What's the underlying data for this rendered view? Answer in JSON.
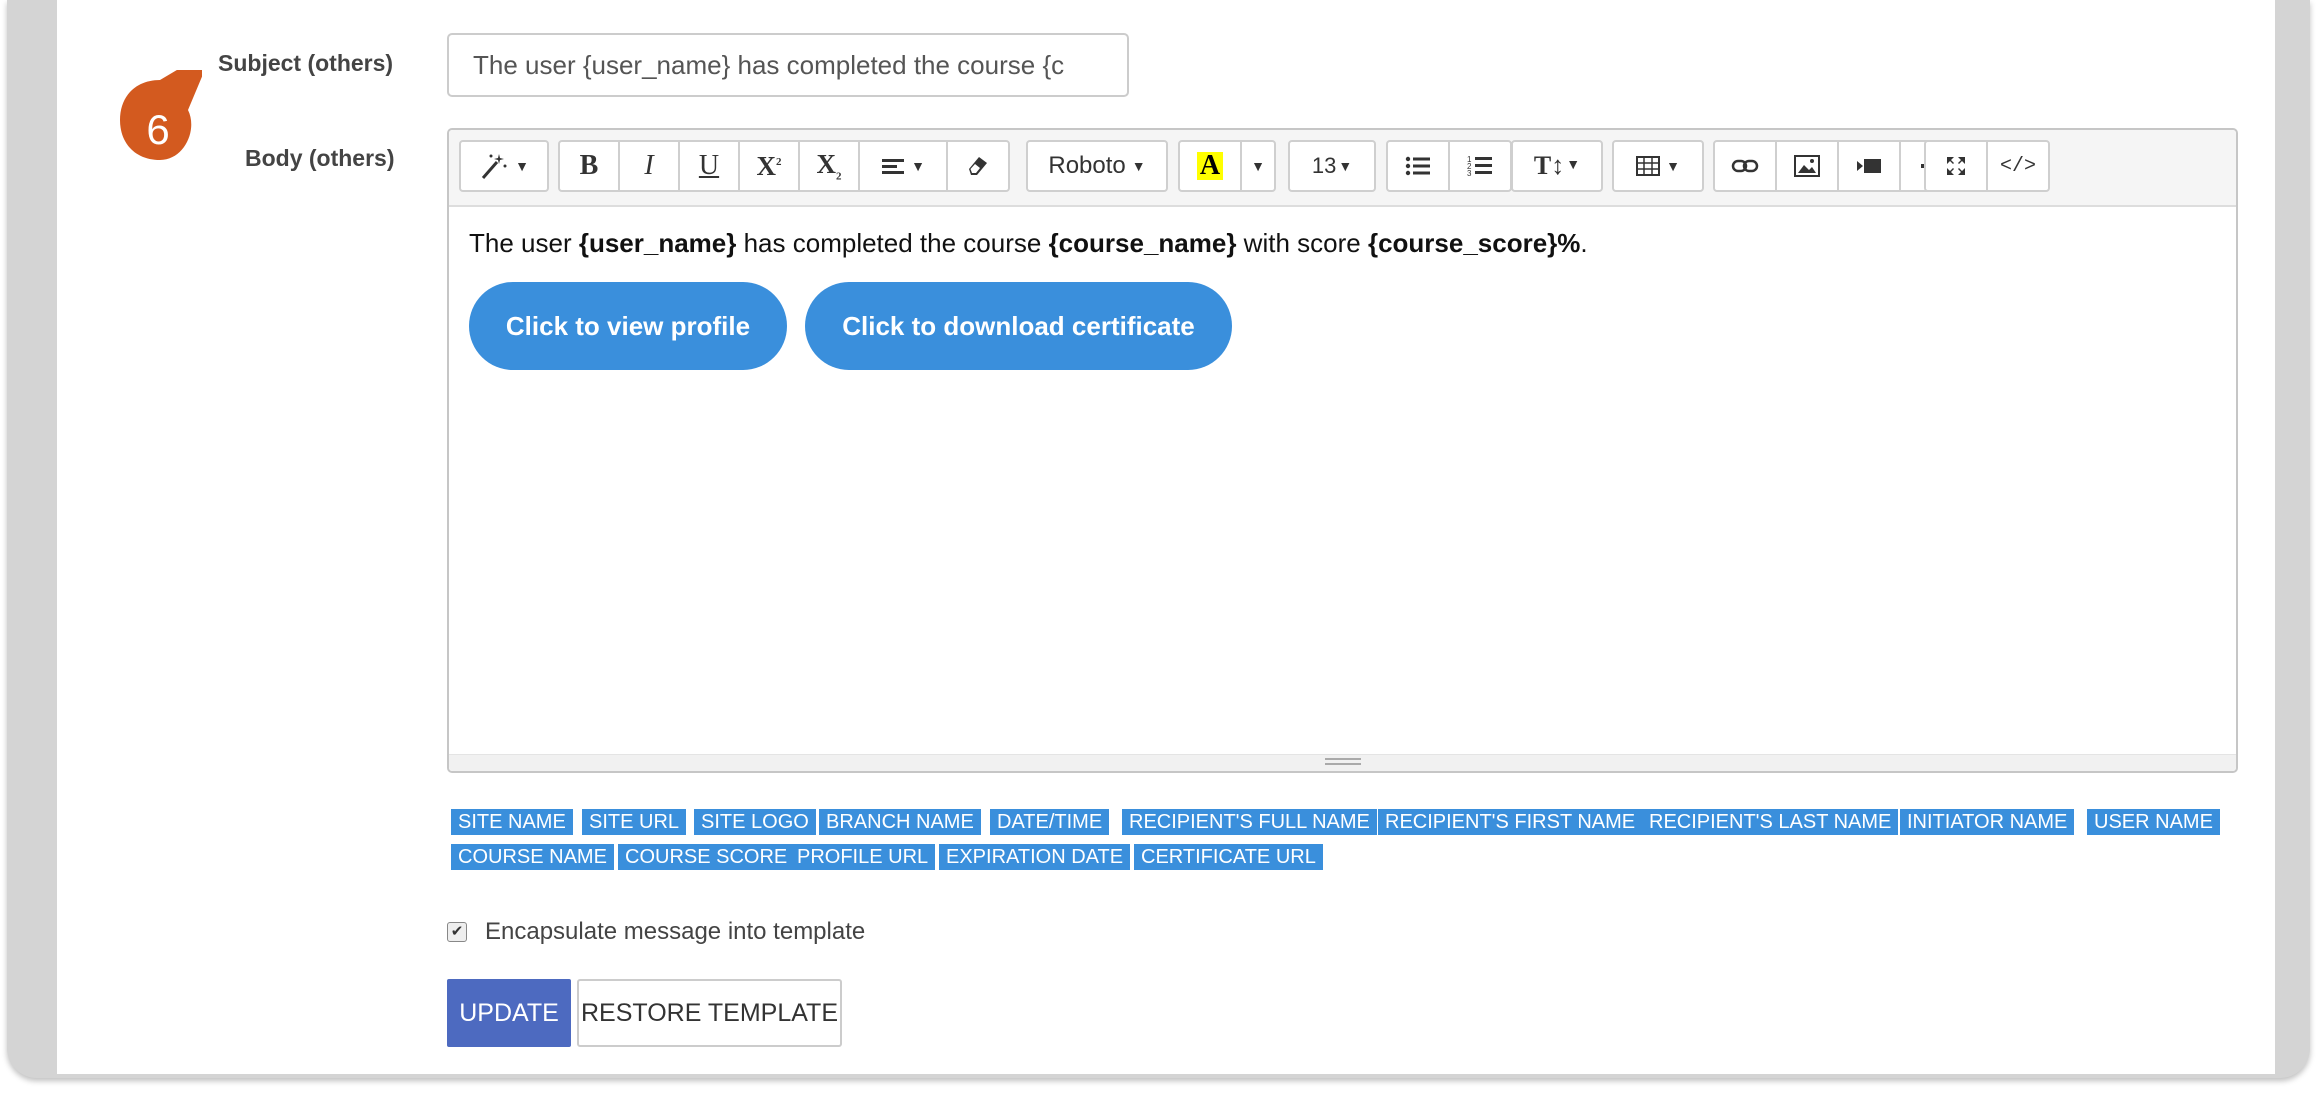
{
  "form": {
    "subject_label": "Subject (others)",
    "body_label": "Body (others)",
    "subject_value": "The user {user_name} has completed the course {c"
  },
  "callout": {
    "number": "6",
    "color": "#d35a1f"
  },
  "toolbar": {
    "font_name": "Roboto",
    "font_size": "13",
    "highlight_letter": "A",
    "icons": [
      "magic-wand-icon",
      "bold-icon",
      "italic-icon",
      "underline-icon",
      "superscript-icon",
      "subscript-icon",
      "align-icon",
      "eraser-icon",
      "font-color-icon",
      "ordered-list-icon",
      "unordered-list-icon",
      "line-height-icon",
      "table-icon",
      "link-icon",
      "image-icon",
      "video-icon",
      "horizontal-rule-icon",
      "fullscreen-icon",
      "code-view-icon"
    ]
  },
  "body": {
    "text_1": "The user ",
    "var_user": "{user_name}",
    "text_2": " has completed the course ",
    "var_course": "{course_name}",
    "text_3": " with score ",
    "var_score": "{course_score}%",
    "text_4": ".",
    "button_profile": "Click to view profile",
    "button_certificate": "Click to download certificate",
    "button_color": "#3a8fdc"
  },
  "tags": [
    "SITE NAME",
    "SITE URL",
    "SITE LOGO",
    "BRANCH NAME",
    "DATE/TIME",
    "RECIPIENT'S FULL NAME",
    "RECIPIENT'S FIRST NAME",
    "RECIPIENT'S LAST NAME",
    "INITIATOR NAME",
    "USER NAME",
    "COURSE NAME",
    "COURSE SCORE",
    "PROFILE URL",
    "EXPIRATION DATE",
    "CERTIFICATE URL"
  ],
  "options": {
    "encapsulate_label": "Encapsulate message into template",
    "encapsulate_checked": true
  },
  "actions": {
    "update_label": "UPDATE",
    "restore_label": "RESTORE TEMPLATE",
    "update_color": "#4d6ac0"
  }
}
